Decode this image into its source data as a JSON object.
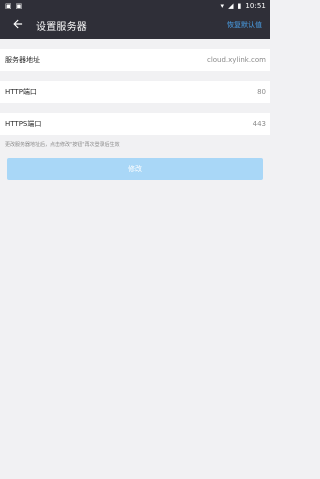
{
  "status_bar": {
    "time": "10:51",
    "left_icons": [
      "b-icon",
      "n-icon"
    ],
    "right_icons": [
      "wifi-icon",
      "signal-icon",
      "battery-icon"
    ]
  },
  "header": {
    "title": "设置服务器",
    "restore_default_label": "恢复默认值"
  },
  "form": {
    "server_address": {
      "label": "服务器地址",
      "value": "cloud.xylink.com"
    },
    "http_port": {
      "label": "HTTP端口",
      "value": "80"
    },
    "https_port": {
      "label": "HTTPS端口",
      "value": "443"
    },
    "hint": "更改服务器地址后，点击修改\"按钮\"再次登录后生效"
  },
  "actions": {
    "submit_label": "修改"
  },
  "colors": {
    "accent": "#4aa0e8",
    "button_disabled": "#a9d7f7",
    "bar_bg": "#2f2f38"
  }
}
